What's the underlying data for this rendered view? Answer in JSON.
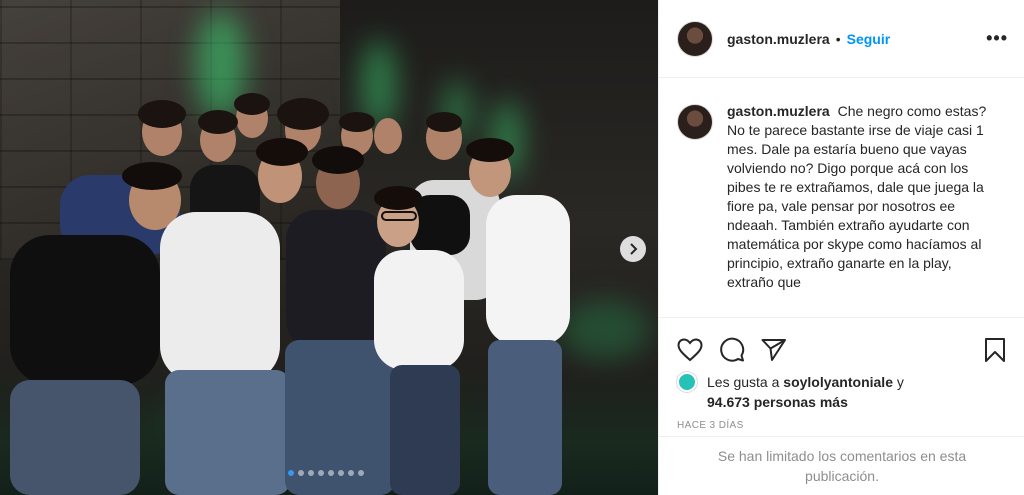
{
  "post": {
    "username": "gaston.muzlera",
    "separator": "•",
    "follow_label": "Seguir",
    "more_label": "•••",
    "caption": "Che negro como estas? No te parece bastante irse de viaje casi 1 mes. Dale pa estaría bueno que vayas volviendo no? Digo porque acá con los pibes te re extrañamos, dale que juega la fiore pa, vale pensar por nosotros ee ndeaah. También extraño ayudarte con matemática por skype como hacíamos al principio, extraño ganarte en la play, extraño que",
    "likes_prefix": "Les gusta a",
    "likes_user": "soylolyantoniale",
    "likes_and": "y",
    "likes_count": "94.673 personas más",
    "timestamp": "Hace 3 días",
    "comments_limited": "Se han limitado los comentarios en esta publicación."
  },
  "carousel": {
    "total": 8,
    "active_index": 0
  },
  "icons": {
    "like": "heart-icon",
    "comment": "comment-icon",
    "share": "share-icon",
    "save": "bookmark-icon",
    "next": "chevron-right-icon"
  },
  "colors": {
    "follow": "#0095f6",
    "muted": "#8e8e8e",
    "text": "#262626",
    "liker_avatar": "#26c2b8"
  }
}
